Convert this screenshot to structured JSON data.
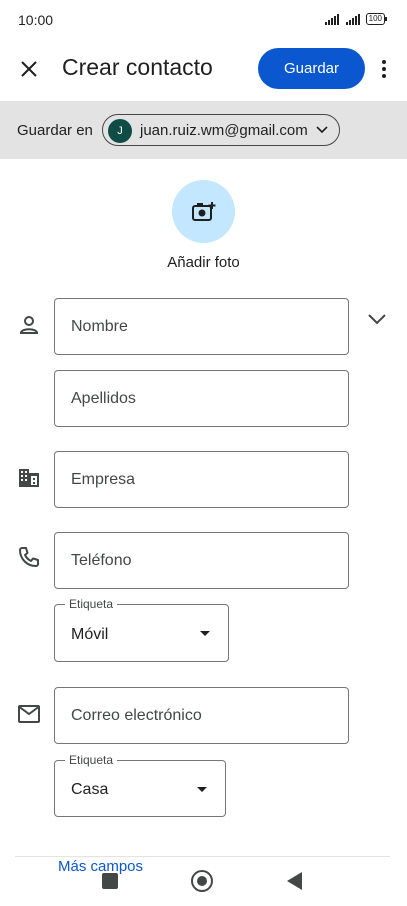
{
  "status_bar": {
    "time": "10:00",
    "battery": "100"
  },
  "app_bar": {
    "close_icon": "close-icon",
    "title": "Crear contacto",
    "save_label": "Guardar",
    "more_icon": "more-vert-icon"
  },
  "account": {
    "label": "Guardar en",
    "avatar_letter": "J",
    "email": "juan.ruiz.wm@gmail.com",
    "avatar_color": "#0f4c45"
  },
  "photo": {
    "label": "Añadir foto"
  },
  "form": {
    "first_name_placeholder": "Nombre",
    "last_name_placeholder": "Apellidos",
    "company_placeholder": "Empresa",
    "phone_placeholder": "Teléfono",
    "phone_label_legend": "Etiqueta",
    "phone_label_value": "Móvil",
    "email_placeholder": "Correo electrónico",
    "email_label_legend": "Etiqueta",
    "email_label_value": "Casa"
  },
  "more_fields": "Más campos",
  "colors": {
    "accent": "#0b57d0",
    "account_bar": "#e3e3e3",
    "photo_bg": "#c2e7ff"
  }
}
